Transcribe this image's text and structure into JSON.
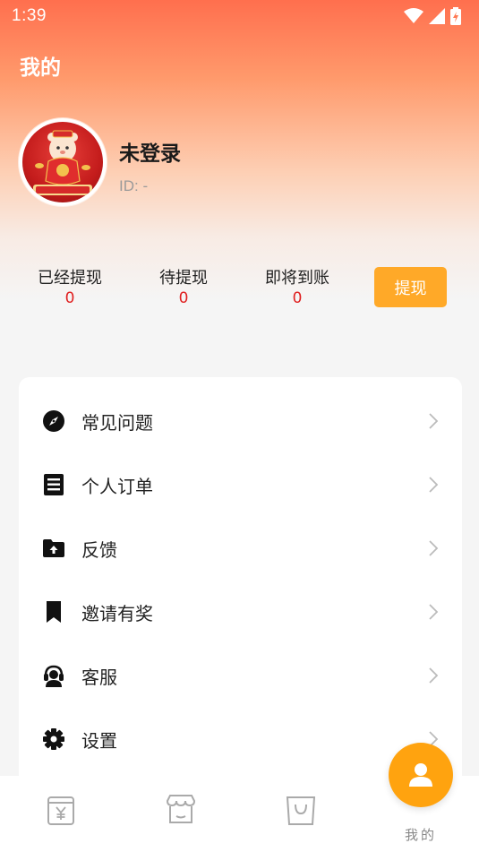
{
  "status_bar": {
    "time": "1:39"
  },
  "header": {
    "title": "我的"
  },
  "profile": {
    "name": "未登录",
    "id_text": "ID: -"
  },
  "stats": [
    {
      "label": "已经提现",
      "value": "0"
    },
    {
      "label": "待提现",
      "value": "0"
    },
    {
      "label": "即将到账",
      "value": "0"
    }
  ],
  "withdraw_button": "提现",
  "menu": [
    {
      "label": "常见问题",
      "icon": "compass-icon"
    },
    {
      "label": "个人订单",
      "icon": "order-list-icon"
    },
    {
      "label": "反馈",
      "icon": "folder-upload-icon"
    },
    {
      "label": "邀请有奖",
      "icon": "bookmark-icon"
    },
    {
      "label": "客服",
      "icon": "headset-icon"
    },
    {
      "label": "设置",
      "icon": "gear-icon"
    }
  ],
  "tabbar": {
    "tabs": [
      {
        "icon": "wallet-yen-icon"
      },
      {
        "icon": "store-icon"
      },
      {
        "icon": "shopping-bag-icon"
      },
      {
        "icon": "person-icon",
        "label": "我的",
        "active": true
      }
    ]
  },
  "colors": {
    "header_gradient_top": "#ff6f4e",
    "withdraw_button": "#ffa928",
    "stat_value": "#e02020",
    "active_tab": "#ffa30f"
  }
}
